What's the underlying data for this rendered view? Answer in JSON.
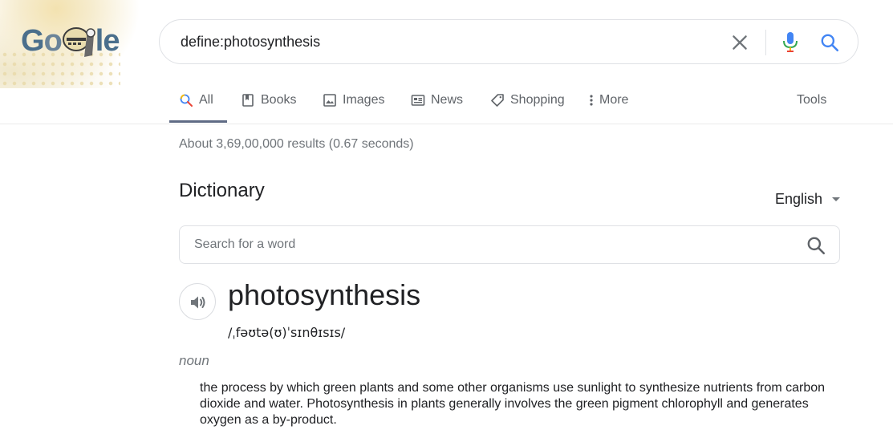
{
  "header": {
    "logo_text": "Google",
    "search_query": "define:photosynthesis",
    "icons": {
      "clear": "close-icon",
      "voice": "microphone-icon",
      "search": "search-icon"
    }
  },
  "tabs": [
    {
      "label": "All",
      "icon": "search-icon",
      "active": true
    },
    {
      "label": "Books",
      "icon": "book-icon"
    },
    {
      "label": "Images",
      "icon": "image-icon"
    },
    {
      "label": "News",
      "icon": "news-icon"
    },
    {
      "label": "Shopping",
      "icon": "tag-icon"
    },
    {
      "label": "More",
      "icon": "more-vert-icon"
    }
  ],
  "tools_label": "Tools",
  "result_stats": "About 3,69,00,000 results (0.67 seconds)",
  "dictionary": {
    "title": "Dictionary",
    "language": "English",
    "search_placeholder": "Search for a word",
    "headword": "photosynthesis",
    "phonetic": "/ˌfəʊtə(ʊ)ˈsɪnθɪsɪs/",
    "part_of_speech": "noun",
    "definition": "the process by which green plants and some other organisms use sunlight to synthesize nutrients from carbon dioxide and water. Photosynthesis in plants generally involves the green pigment chlorophyll and generates oxygen as a by-product."
  },
  "colors": {
    "active_tab": "#1a73e8",
    "muted_text": "#70757a",
    "border": "#dfe1e5"
  }
}
